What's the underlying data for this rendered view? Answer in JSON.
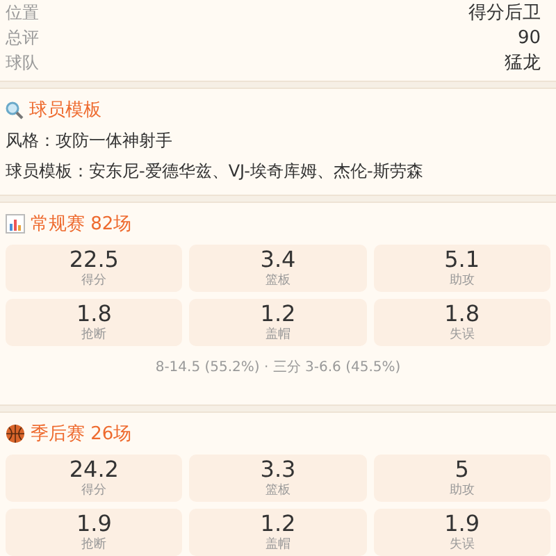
{
  "info_rows": [
    {
      "label": "位置",
      "value": "得分后卫"
    },
    {
      "label": "总评",
      "value": "90"
    },
    {
      "label": "球队",
      "value": "猛龙"
    }
  ],
  "template": {
    "title": "球员模板",
    "lines": [
      "风格：攻防一体神射手",
      "球员模板：安东尼-爱德华兹、VJ-埃奇库姆、杰伦-斯劳森"
    ]
  },
  "sections": [
    {
      "kind": "chart",
      "title": "常规赛 82场",
      "stats": [
        {
          "value": "22.5",
          "label": "得分"
        },
        {
          "value": "3.4",
          "label": "篮板"
        },
        {
          "value": "5.1",
          "label": "助攻"
        },
        {
          "value": "1.8",
          "label": "抢断"
        },
        {
          "value": "1.2",
          "label": "盖帽"
        },
        {
          "value": "1.8",
          "label": "失误"
        }
      ],
      "summary": "8-14.5 (55.2%) · 三分 3-6.6 (45.5%)"
    },
    {
      "kind": "ball",
      "title": "季后赛 26场",
      "stats": [
        {
          "value": "24.2",
          "label": "得分"
        },
        {
          "value": "3.3",
          "label": "篮板"
        },
        {
          "value": "5",
          "label": "助攻"
        },
        {
          "value": "1.9",
          "label": "抢断"
        },
        {
          "value": "1.2",
          "label": "盖帽"
        },
        {
          "value": "1.9",
          "label": "失误"
        }
      ]
    }
  ]
}
